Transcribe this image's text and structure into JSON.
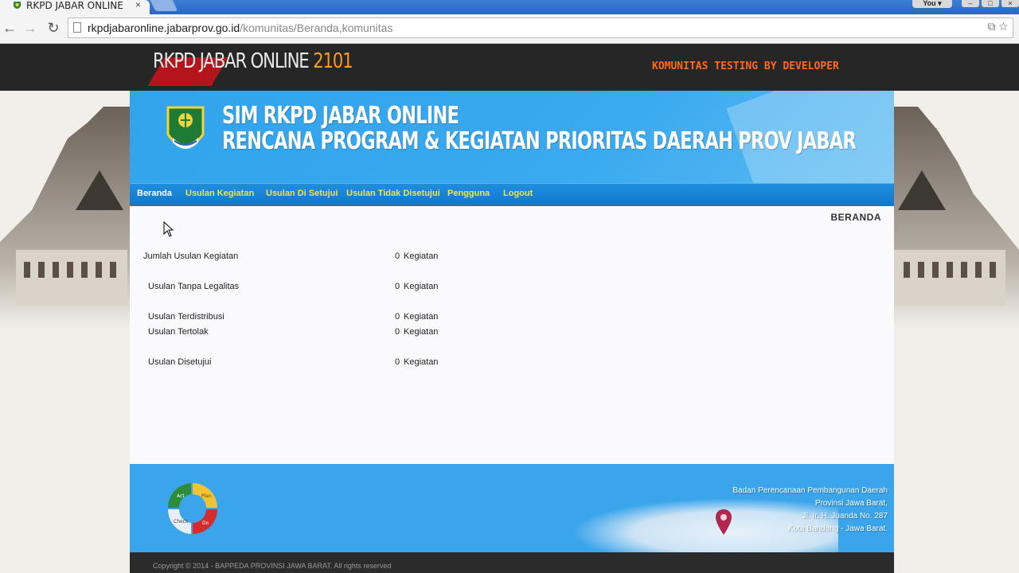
{
  "browser": {
    "tab_title": "RKPD JABAR ONLINE",
    "tab_close": "×",
    "profile_label": "You",
    "url_host": "rkpdjabaronline.jabarprov.go.id",
    "url_path": "/komunitas/Beranda,komunitas"
  },
  "site": {
    "brand_text": "RKPD JABAR ONLINE ",
    "brand_year": "2101",
    "dev_text": "KOMUNITAS TESTING BY DEVELOPER",
    "header_title": "SIM RKPD JABAR ONLINE",
    "header_subtitle": "RENCANA PROGRAM & KEGIATAN PRIORITAS DAERAH PROV JABAR"
  },
  "menu": {
    "items": [
      {
        "label": "Beranda"
      },
      {
        "label": "Usulan Kegiatan"
      },
      {
        "label": "Usulan Di Setujui"
      },
      {
        "label": "Usulan Tidak Disetujui"
      },
      {
        "label": "Pengguna"
      },
      {
        "label": "Logout"
      }
    ]
  },
  "main": {
    "heading": "BERANDA",
    "stats": [
      {
        "label": "Jumlah Usulan Kegiatan",
        "count": "0",
        "unit": "Kegiatan"
      },
      {
        "label": "Usulan Tanpa Legalitas",
        "count": "0",
        "unit": "Kegiatan"
      },
      {
        "label": "Usulan Terdistribusi",
        "count": "0",
        "unit": "Kegiatan"
      },
      {
        "label": "Usulan Tertolak",
        "count": "0",
        "unit": "Kegiatan"
      },
      {
        "label": "Usulan Disetujui",
        "count": "0",
        "unit": "Kegiatan"
      }
    ]
  },
  "footer": {
    "address_lines": [
      "Badan Perencanaan Pembangunan Daerah",
      "Provinsi Jawa Barat,",
      "Jl. Ir. H. Juanda No. 287",
      "Kota Bandung - Jawa Barat."
    ],
    "pdca": [
      "Act",
      "Plan",
      "Check",
      "Do"
    ],
    "copyright": "Copyright © 2014 - BAPPEDA PROVINSI JAWA BARAT. All rights reserved"
  },
  "colors": {
    "header_blue": "#3aa9ef",
    "menu_link": "#f2e54a",
    "dev_text": "#ff6a1a",
    "brand_year": "#f19a2b"
  }
}
